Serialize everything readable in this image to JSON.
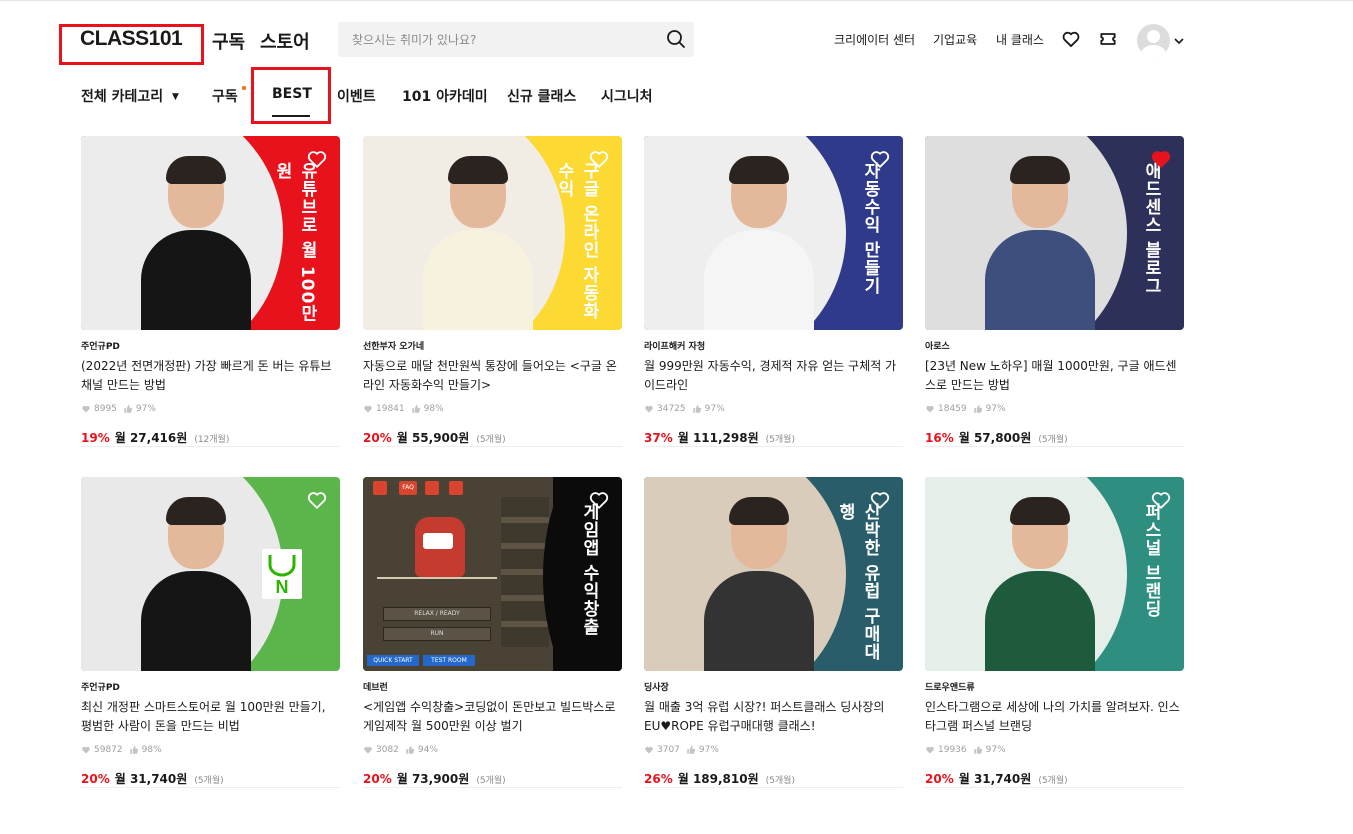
{
  "header": {
    "logo": "CLASS101",
    "nav": [
      "구독",
      "스토어"
    ],
    "search_placeholder": "찾으시는 취미가 있나요?",
    "links": [
      "크리에이터 센터",
      "기업교육",
      "내 클래스"
    ]
  },
  "categories": {
    "all": "전체 카테고리",
    "tabs": [
      "구독",
      "BEST",
      "이벤트",
      "101 아카데미",
      "신규 클래스",
      "시그니처"
    ],
    "active": "BEST"
  },
  "cards": [
    {
      "creator": "주언규PD",
      "title": "(2022년 전면개정판) 가장 빠르게 돈 버는 유튜브 채널 만드는 방법",
      "likes": "8995",
      "rating": "97%",
      "discount": "19%",
      "price": "월 27,416원",
      "months": "(12개월)",
      "banner": "유튜브로 월 100만원",
      "bg": "#e8121c",
      "circle": "#ececec",
      "shirt": "#151515",
      "liked": false
    },
    {
      "creator": "선한부자 오가네",
      "title": "자동으로 매달 천만원씩 통장에 들어오는 <구글 온라인 자동화수익 만들기>",
      "likes": "19841",
      "rating": "98%",
      "discount": "20%",
      "price": "월 55,900원",
      "months": "(5개월)",
      "banner": "구글 온라인 자동화 수익",
      "bg": "#fcd933",
      "circle": "#f1ede4",
      "shirt": "#f6f2dd",
      "liked": false
    },
    {
      "creator": "라이프해커 자청",
      "title": "월 999만원 자동수익, 경제적 자유 얻는 구체적 가이드라인",
      "likes": "34725",
      "rating": "97%",
      "discount": "37%",
      "price": "월 111,298원",
      "months": "(5개월)",
      "banner": "자동수익 만들기",
      "bg": "#2f3a8a",
      "circle": "#eeeeee",
      "shirt": "#f5f5f5",
      "liked": false
    },
    {
      "creator": "아로스",
      "title": "[23년 New 노하우] 매월 1000만원, 구글 애드센스로 만드는 방법",
      "likes": "18459",
      "rating": "97%",
      "discount": "16%",
      "price": "월 57,800원",
      "months": "(5개월)",
      "banner": "애드센스 블로그",
      "bg": "#2d3059",
      "circle": "#dedede",
      "shirt": "#3c4f7d",
      "liked": true
    },
    {
      "creator": "주언규PD",
      "title": "최신 개정판 스마트스토어로 월 100만원 만들기, 평범한 사람이 돈을 만드는 비법",
      "likes": "59872",
      "rating": "98%",
      "discount": "20%",
      "price": "월 31,740원",
      "months": "(5개월)",
      "banner": "",
      "bg": "#5cb54a",
      "circle": "#e9e9e9",
      "shirt": "#151515",
      "liked": false
    },
    {
      "creator": "데브런",
      "title": "<게임앱 수익창출>코딩없이 돈만보고 빌드박스로 게임제작 월 500만원 이상 벌기",
      "likes": "3082",
      "rating": "94%",
      "discount": "20%",
      "price": "월 73,900원",
      "months": "(5개월)",
      "banner": "게임앱 수익창출",
      "bg": "#0b0b0b",
      "circle": "#0b0b0b",
      "shirt": "#c53b2f",
      "liked": false
    },
    {
      "creator": "딩사장",
      "title": "월 매출 3억 유럽 시장?! 퍼스트클래스 딩사장의 EU♥ROPE 유럽구매대행 클래스!",
      "likes": "3707",
      "rating": "97%",
      "discount": "26%",
      "price": "월 189,810원",
      "months": "(5개월)",
      "banner": "신박한 유럽 구매대행",
      "bg": "#2a5d6a",
      "circle": "#d9ccbb",
      "shirt": "#333333",
      "liked": false
    },
    {
      "creator": "드로우앤드류",
      "title": "인스타그램으로 세상에 나의 가치를 알려보자. 인스타그램 퍼스널 브랜딩",
      "likes": "19936",
      "rating": "97%",
      "discount": "20%",
      "price": "월 31,740원",
      "months": "(5개월)",
      "banner": "퍼스널 브랜딩",
      "bg": "#2e8f80",
      "circle": "#e6eeea",
      "shirt": "#1e5a3c",
      "liked": false
    }
  ],
  "game_ui": {
    "relax": "RELAX / READY",
    "run": "RUN",
    "quick": "QUICK START",
    "test": "TEST ROOM",
    "faq": "FAQ"
  }
}
